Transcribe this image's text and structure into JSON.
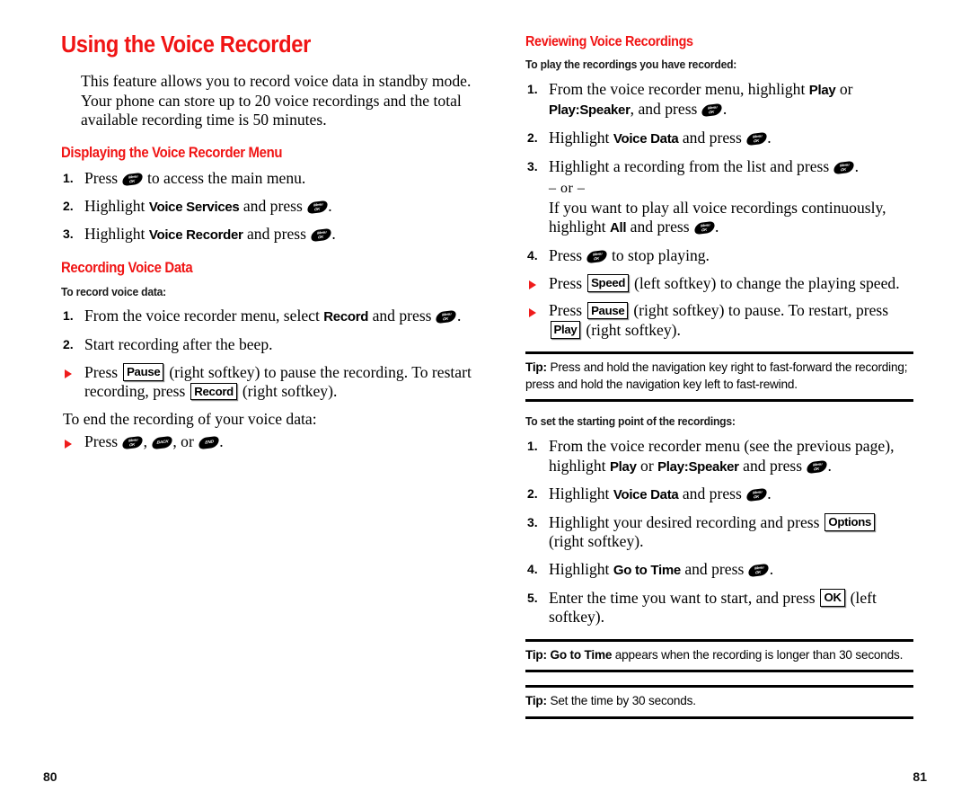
{
  "document": {
    "type": "phone-user-guide-spread",
    "accent_color": "#f01414",
    "bullet_color": "#ef1c1c",
    "text_color": "#000000"
  },
  "icons": {
    "ok_key": {
      "name": "ok-key-icon",
      "line1": "Menu",
      "line2": "OK"
    },
    "back_key": {
      "name": "back-key-icon",
      "label": "BACK"
    },
    "end_key": {
      "name": "end-key-icon",
      "label": "END"
    }
  },
  "left_page": {
    "folio": "80",
    "title": "Using the Voice Recorder",
    "intro": "This feature allows you to record voice data in standby mode. Your phone can store up to 20 voice recordings and the total available recording time is 50 minutes.",
    "section_displaying": {
      "heading": "Displaying the Voice Recorder Menu",
      "steps": [
        {
          "num": "1.",
          "pre": "Press",
          "post": "to access the main menu."
        },
        {
          "num": "2.",
          "pre": "Highlight",
          "bold": "Voice Services",
          "mid": "and press",
          "post": "."
        },
        {
          "num": "3.",
          "pre": "Highlight",
          "bold": "Voice Recorder",
          "mid": "and press",
          "post": "."
        }
      ]
    },
    "section_recording": {
      "heading": "Recording Voice Data",
      "subheading": "To record voice data:",
      "steps": [
        {
          "num": "1.",
          "pre": "From the voice recorder menu, select",
          "bold": "Record",
          "mid": "and press",
          "post": "."
        },
        {
          "num": "2.",
          "pre": "Start recording after the beep."
        }
      ],
      "bullet_pause": {
        "pre": "Press",
        "key1": "Pause",
        "mid": "(right softkey) to pause the recording. To restart recording, press",
        "key2": "Record",
        "post": "(right softkey)."
      },
      "end_line": "To end the recording of your voice data:",
      "bullet_end": {
        "pre": "Press",
        "sep1": ",",
        "sep2": ", or",
        "post": "."
      }
    }
  },
  "right_page": {
    "folio": "81",
    "section_reviewing": {
      "heading": "Reviewing Voice Recordings",
      "subheading": "To play the recordings you have recorded:",
      "steps": [
        {
          "num": "1.",
          "pre": "From the voice recorder menu, highlight",
          "bold1": "Play",
          "mid1": "or",
          "bold2": "Play:Speaker",
          "mid2": ", and press",
          "post": "."
        },
        {
          "num": "2.",
          "pre": "Highlight",
          "bold1": "Voice Data",
          "mid1": "and press",
          "post": "."
        },
        {
          "num": "3.",
          "pre": "Highlight a recording from the list and press",
          "post": ".",
          "or_marker": "– or –",
          "alt_pre": "If you want to play all voice recordings continuously, highlight",
          "alt_bold": "All",
          "alt_mid": "and press",
          "alt_post": "."
        },
        {
          "num": "4.",
          "pre": "Press",
          "mid1": "to stop playing.",
          "post": ""
        }
      ],
      "bullet_speed": {
        "pre": "Press",
        "key1": "Speed",
        "post": "(left softkey) to change the playing speed."
      },
      "bullet_pause": {
        "pre": "Press",
        "key1": "Pause",
        "mid": "(right softkey) to pause. To restart, press",
        "key2": "Play",
        "post": "(right softkey)."
      }
    },
    "tip_navigation": {
      "label": "Tip:",
      "text": " Press and hold the navigation key right to fast-forward the recording; press and hold the navigation key left to fast-rewind."
    },
    "section_starting_point": {
      "subheading": "To set the starting point of the recordings:",
      "steps": [
        {
          "num": "1.",
          "pre": "From the voice recorder menu (see the previous page), highlight",
          "bold1": "Play",
          "mid1": "or",
          "bold2": "Play:Speaker",
          "mid2": "and press",
          "post": "."
        },
        {
          "num": "2.",
          "pre": "Highlight",
          "bold1": "Voice Data",
          "mid1": "and press",
          "post": "."
        },
        {
          "num": "3.",
          "pre": "Highlight your desired recording and press",
          "key1": "Options",
          "post": "(right softkey)."
        },
        {
          "num": "4.",
          "pre": "Highlight",
          "bold1": "Go to Time",
          "mid1": "and press",
          "post": "."
        },
        {
          "num": "5.",
          "pre": "Enter the time you want to start, and press",
          "key1": "OK",
          "post": "(left softkey)."
        }
      ]
    },
    "tip_go_to_time": {
      "label": "Tip:",
      "bold": " Go to Time",
      "text": " appears when the recording is longer than 30 seconds."
    },
    "tip_set_time": {
      "label": "Tip:",
      "text": " Set the time by 30 seconds."
    }
  }
}
